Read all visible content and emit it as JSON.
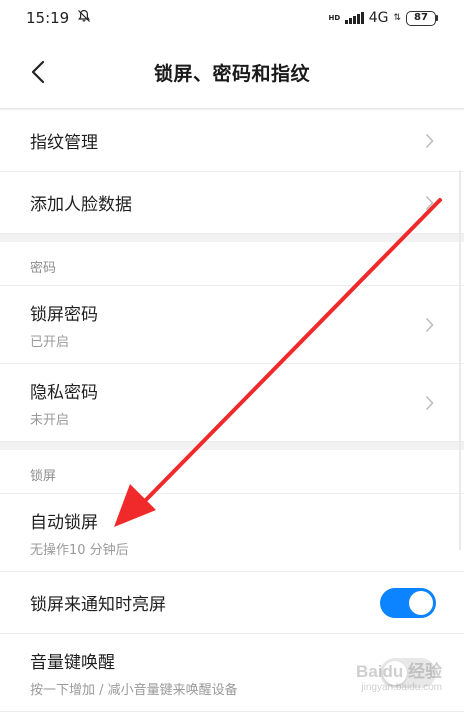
{
  "status_bar": {
    "time": "15:19",
    "network": "4G",
    "hd_label": "HD",
    "battery": "87"
  },
  "header": {
    "title": "锁屏、密码和指纹",
    "back_icon": "back-arrow-icon"
  },
  "rows_top": [
    {
      "label": "指纹管理"
    },
    {
      "label": "添加人脸数据"
    }
  ],
  "section_password": {
    "header": "密码",
    "items": [
      {
        "label": "锁屏密码",
        "sub": "已开启"
      },
      {
        "label": "隐私密码",
        "sub": "未开启"
      }
    ]
  },
  "section_lock": {
    "header": "锁屏",
    "auto_lock": {
      "label": "自动锁屏",
      "sub": "无操作10 分钟后"
    },
    "wake_on_notify": {
      "label": "锁屏来通知时亮屏",
      "toggle": "on"
    },
    "volume_wake": {
      "label": "音量键唤醒",
      "sub": "按一下增加 / 减小音量键来唤醒设备",
      "toggle": "off"
    }
  },
  "watermark": {
    "main": "Baidu 经验",
    "sub": "jingyan.baidu.com"
  },
  "colors": {
    "accent": "#0d84ff",
    "annotation_arrow": "#f02a2a"
  }
}
